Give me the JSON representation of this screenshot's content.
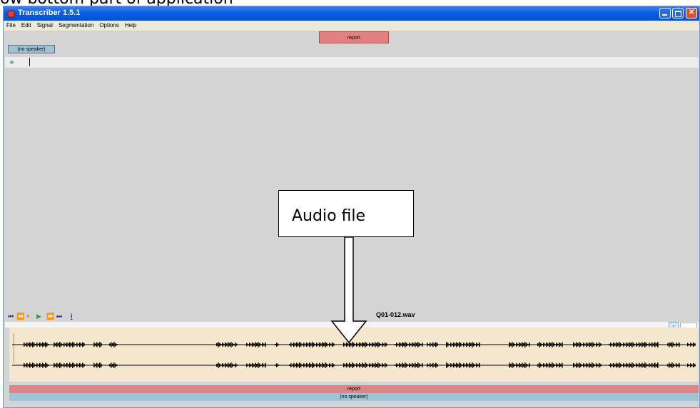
{
  "document": {
    "caption_partial": "ow bottom part of application"
  },
  "window": {
    "title": "Transcriber 1.5.1",
    "menu": [
      "File",
      "Edit",
      "Signal",
      "Segmentation",
      "Options",
      "Help"
    ],
    "top_section_label": "report",
    "speaker_tag": "(no speaker)"
  },
  "player": {
    "controls": [
      "skip-to-start",
      "rewind",
      "pause",
      "play",
      "fast-forward",
      "skip-to-end"
    ],
    "info_label": "i",
    "file_name": "Q01-012.wav"
  },
  "timeline": {
    "section_label": "report",
    "speaker_label": "(no speaker)"
  },
  "annotation": {
    "callout_text": "Audio file"
  },
  "colors": {
    "section_bar": "#e58080",
    "speaker_bar": "#9ec4d6",
    "waveform_bg": "#f5e7cd",
    "titlebar": "#0a5fe0"
  }
}
